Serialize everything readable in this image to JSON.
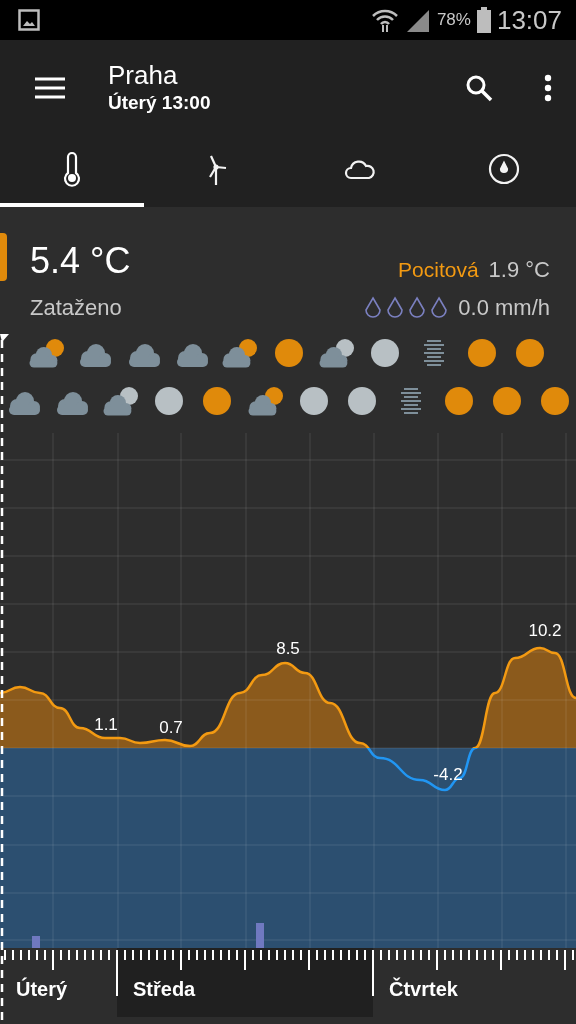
{
  "status_bar": {
    "battery": "78%",
    "time": "13:07"
  },
  "app_bar": {
    "title": "Praha",
    "subtitle": "Úterý 13:00"
  },
  "tabs": [
    {
      "kind": "temperature",
      "selected": true
    },
    {
      "kind": "wind",
      "selected": false
    },
    {
      "kind": "clouds",
      "selected": false
    },
    {
      "kind": "humidity",
      "selected": false
    }
  ],
  "current": {
    "temperature": "5.4 °C",
    "condition": "Zataženo",
    "feels_like_label": "Pocitová",
    "feels_like": "1.9 °C",
    "precipitation": "0.0 mm/h"
  },
  "forecast_rows": [
    [
      {
        "kind": "partly-day"
      },
      {
        "kind": "cloudy"
      },
      {
        "kind": "cloudy"
      },
      {
        "kind": "cloudy"
      },
      {
        "kind": "partly-day"
      },
      {
        "kind": "sun"
      },
      {
        "kind": "partly-night"
      },
      {
        "kind": "moon"
      },
      {
        "kind": "fog"
      },
      {
        "kind": "sun"
      },
      {
        "kind": "sun"
      }
    ],
    [
      {
        "kind": "cloudy"
      },
      {
        "kind": "cloudy"
      },
      {
        "kind": "partly-night"
      },
      {
        "kind": "moon"
      },
      {
        "kind": "sun"
      },
      {
        "kind": "partly-day"
      },
      {
        "kind": "moon"
      },
      {
        "kind": "moon"
      },
      {
        "kind": "fog"
      },
      {
        "kind": "sun"
      },
      {
        "kind": "sun"
      },
      {
        "kind": "sun"
      }
    ]
  ],
  "temperature_labels": [
    "1.1",
    "0.7",
    "8.5",
    "-4.2",
    "10.2"
  ],
  "days": [
    {
      "label": "Úterý",
      "selected": false
    },
    {
      "label": "Středa",
      "selected": true
    },
    {
      "label": "Čtvrtek",
      "selected": false
    }
  ]
}
